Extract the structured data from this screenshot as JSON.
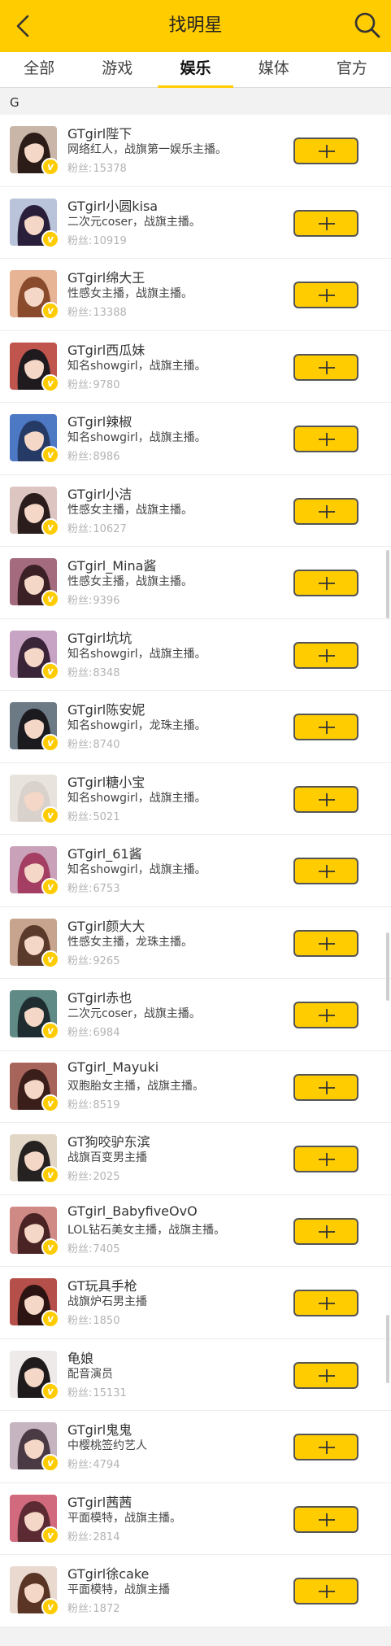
{
  "header": {
    "title": "找明星",
    "back_icon": "chevron-left-icon",
    "search_icon": "search-icon"
  },
  "tabs": [
    {
      "label": "全部",
      "active": false
    },
    {
      "label": "游戏",
      "active": false
    },
    {
      "label": "娱乐",
      "active": true
    },
    {
      "label": "媒体",
      "active": false
    },
    {
      "label": "官方",
      "active": false
    }
  ],
  "section": {
    "letter": "G"
  },
  "fans_label": "粉丝:",
  "follow_icon": "plus-icon",
  "colors": {
    "accent": "#ffcc00",
    "badge_text": "#ffffff",
    "fans_text": "#b3b3b3"
  },
  "items": [
    {
      "name": "GTgirl陛下",
      "desc": "网络红人，战旗第一娱乐主播。",
      "fans": "15378",
      "avatar_color": "#c9b6a8",
      "hair": "#2b1c18"
    },
    {
      "name": "GTgirl小圆kisa",
      "desc": "二次元coser，战旗主播。",
      "fans": "10919",
      "avatar_color": "#b9c3d9",
      "hair": "#2a1f3a"
    },
    {
      "name": "GTgirl绵大王",
      "desc": "性感女主播，战旗主播。",
      "fans": "13388",
      "avatar_color": "#e7b496",
      "hair": "#8a4a2c"
    },
    {
      "name": "GTgirl西瓜妹",
      "desc": "知名showgirl，战旗主播。",
      "fans": "9780",
      "avatar_color": "#c0554e",
      "hair": "#1e1a1e"
    },
    {
      "name": "GTgirl辣椒",
      "desc": "知名showgirl，战旗主播。",
      "fans": "8986",
      "avatar_color": "#4c78c4",
      "hair": "#263a66"
    },
    {
      "name": "GTgirl小洁",
      "desc": "性感女主播，战旗主播。",
      "fans": "10627",
      "avatar_color": "#ddc6c1",
      "hair": "#2a1d1c"
    },
    {
      "name": "GTgirl_Mina酱",
      "desc": "性感女主播，战旗主播。",
      "fans": "9396",
      "avatar_color": "#a46b7e",
      "hair": "#3b2026"
    },
    {
      "name": "GTgirl坑坑",
      "desc": "知名showgirl，战旗主播。",
      "fans": "8348",
      "avatar_color": "#c7a3c4",
      "hair": "#3a2438"
    },
    {
      "name": "GTgirl陈安妮",
      "desc": "知名showgirl，龙珠主播。",
      "fans": "8740",
      "avatar_color": "#6c7a86",
      "hair": "#1b1a1e"
    },
    {
      "name": "GTgirl糖小宝",
      "desc": "知名showgirl，战旗主播。",
      "fans": "5021",
      "avatar_color": "#e8e3dc",
      "hair": "#d9d2cc"
    },
    {
      "name": "GTgirl_61酱",
      "desc": "知名showgirl，战旗主播。",
      "fans": "6753",
      "avatar_color": "#c9a2b9",
      "hair": "#a43f63"
    },
    {
      "name": "GTgirl颜大大",
      "desc": "性感女主播，龙珠主播。",
      "fans": "9265",
      "avatar_color": "#c7a48d",
      "hair": "#5a3a2a"
    },
    {
      "name": "GTgirl赤也",
      "desc": "二次元coser，战旗主播。",
      "fans": "6984",
      "avatar_color": "#5f8a86",
      "hair": "#1f2d30"
    },
    {
      "name": "GTgirl_Mayuki",
      "desc": "双胞胎女主播，战旗主播。",
      "fans": "8519",
      "avatar_color": "#a6645a",
      "hair": "#3a1e1a"
    },
    {
      "name": "GT狗咬驴东滨",
      "desc": "战旗百变男主播",
      "fans": "2025",
      "avatar_color": "#e2d6c7",
      "hair": "#262221"
    },
    {
      "name": "GTgirl_BabyfiveOvO",
      "desc": "LOL钻石美女主播，战旗主播。",
      "fans": "7405",
      "avatar_color": "#cf8a86",
      "hair": "#4a2424"
    },
    {
      "name": "GT玩具手枪",
      "desc": "战旗炉石男主播",
      "fans": "1850",
      "avatar_color": "#b54f4a",
      "hair": "#2b1412"
    },
    {
      "name": "龟娘",
      "desc": "配音演员",
      "fans": "15131",
      "avatar_color": "#eeeaea",
      "hair": "#1f1a1c"
    },
    {
      "name": "GTgirl鬼鬼",
      "desc": "中樱桃签约艺人",
      "fans": "4794",
      "avatar_color": "#c6b4c0",
      "hair": "#4a3a44"
    },
    {
      "name": "GTgirl茜茜",
      "desc": " 平面模特，战旗主播。",
      "fans": "2814",
      "avatar_color": "#d26a7d",
      "hair": "#5c2a32"
    },
    {
      "name": "GTgirl徐cake",
      "desc": "平面模特，战旗主播",
      "fans": "1872",
      "avatar_color": "#ead9cf",
      "hair": "#5a3526"
    }
  ]
}
